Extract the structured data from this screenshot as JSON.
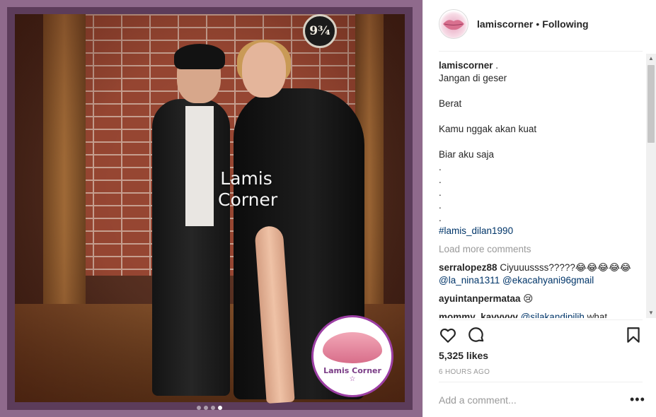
{
  "post": {
    "watermark": "Lamis Corner",
    "watermark_line1": "Lamis",
    "watermark_line2": "Corner",
    "sign_text": "9¾",
    "logo_text": "Lamis Corner",
    "carousel_index": 4,
    "carousel_total": 4
  },
  "header": {
    "username": "lamiscorner",
    "separator": "•",
    "follow_status": "Following"
  },
  "caption": {
    "author": "lamiscorner",
    "author_suffix": " .",
    "lines": [
      "Jangan di geser",
      "",
      "Berat",
      "",
      "Kamu nggak akan kuat",
      "",
      "Biar aku saja",
      ".",
      ".",
      ".",
      ".",
      "."
    ],
    "hashtag": "#lamis_dilan1990"
  },
  "load_more": "Load more comments",
  "comments": [
    {
      "user": "serralopez88",
      "text": " Ciyuuussss?????😂😂😂😂😂",
      "mentions": "@la_nina1311 @ekacahyani96gmail"
    },
    {
      "user": "ayuintanpermataa",
      "text": " 😢"
    },
    {
      "user": "mommy_kavvvvv",
      "mention": " @silakandipilih",
      "text": " what"
    }
  ],
  "likes": "5,325 likes",
  "time": "6 HOURS AGO",
  "add_comment_placeholder": "Add a comment...",
  "more_label": "•••",
  "colors": {
    "link": "#003569",
    "muted": "#999999",
    "text": "#262626",
    "frame": "#8f6a8c"
  },
  "icons": [
    "heart-icon",
    "comment-icon",
    "bookmark-icon",
    "more-icon"
  ]
}
